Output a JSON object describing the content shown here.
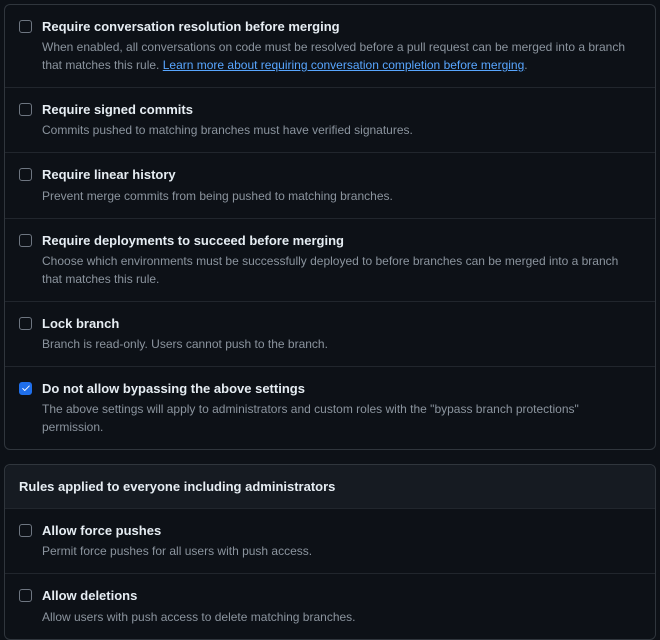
{
  "rules": [
    {
      "title": "Require conversation resolution before merging",
      "desc_pre": "When enabled, all conversations on code must be resolved before a pull request can be merged into a branch that matches this rule. ",
      "link_text": "Learn more about requiring conversation completion before merging",
      "desc_post": ".",
      "checked": false
    },
    {
      "title": "Require signed commits",
      "desc_pre": "Commits pushed to matching branches must have verified signatures.",
      "link_text": "",
      "desc_post": "",
      "checked": false
    },
    {
      "title": "Require linear history",
      "desc_pre": "Prevent merge commits from being pushed to matching branches.",
      "link_text": "",
      "desc_post": "",
      "checked": false
    },
    {
      "title": "Require deployments to succeed before merging",
      "desc_pre": "Choose which environments must be successfully deployed to before branches can be merged into a branch that matches this rule.",
      "link_text": "",
      "desc_post": "",
      "checked": false
    },
    {
      "title": "Lock branch",
      "desc_pre": "Branch is read-only. Users cannot push to the branch.",
      "link_text": "",
      "desc_post": "",
      "checked": false
    },
    {
      "title": "Do not allow bypassing the above settings",
      "desc_pre": "The above settings will apply to administrators and custom roles with the \"bypass branch protections\" permission.",
      "link_text": "",
      "desc_post": "",
      "checked": true
    }
  ],
  "section2": {
    "header": "Rules applied to everyone including administrators",
    "rules": [
      {
        "title": "Allow force pushes",
        "desc_pre": "Permit force pushes for all users with push access.",
        "checked": false
      },
      {
        "title": "Allow deletions",
        "desc_pre": "Allow users with push access to delete matching branches.",
        "checked": false
      }
    ]
  }
}
